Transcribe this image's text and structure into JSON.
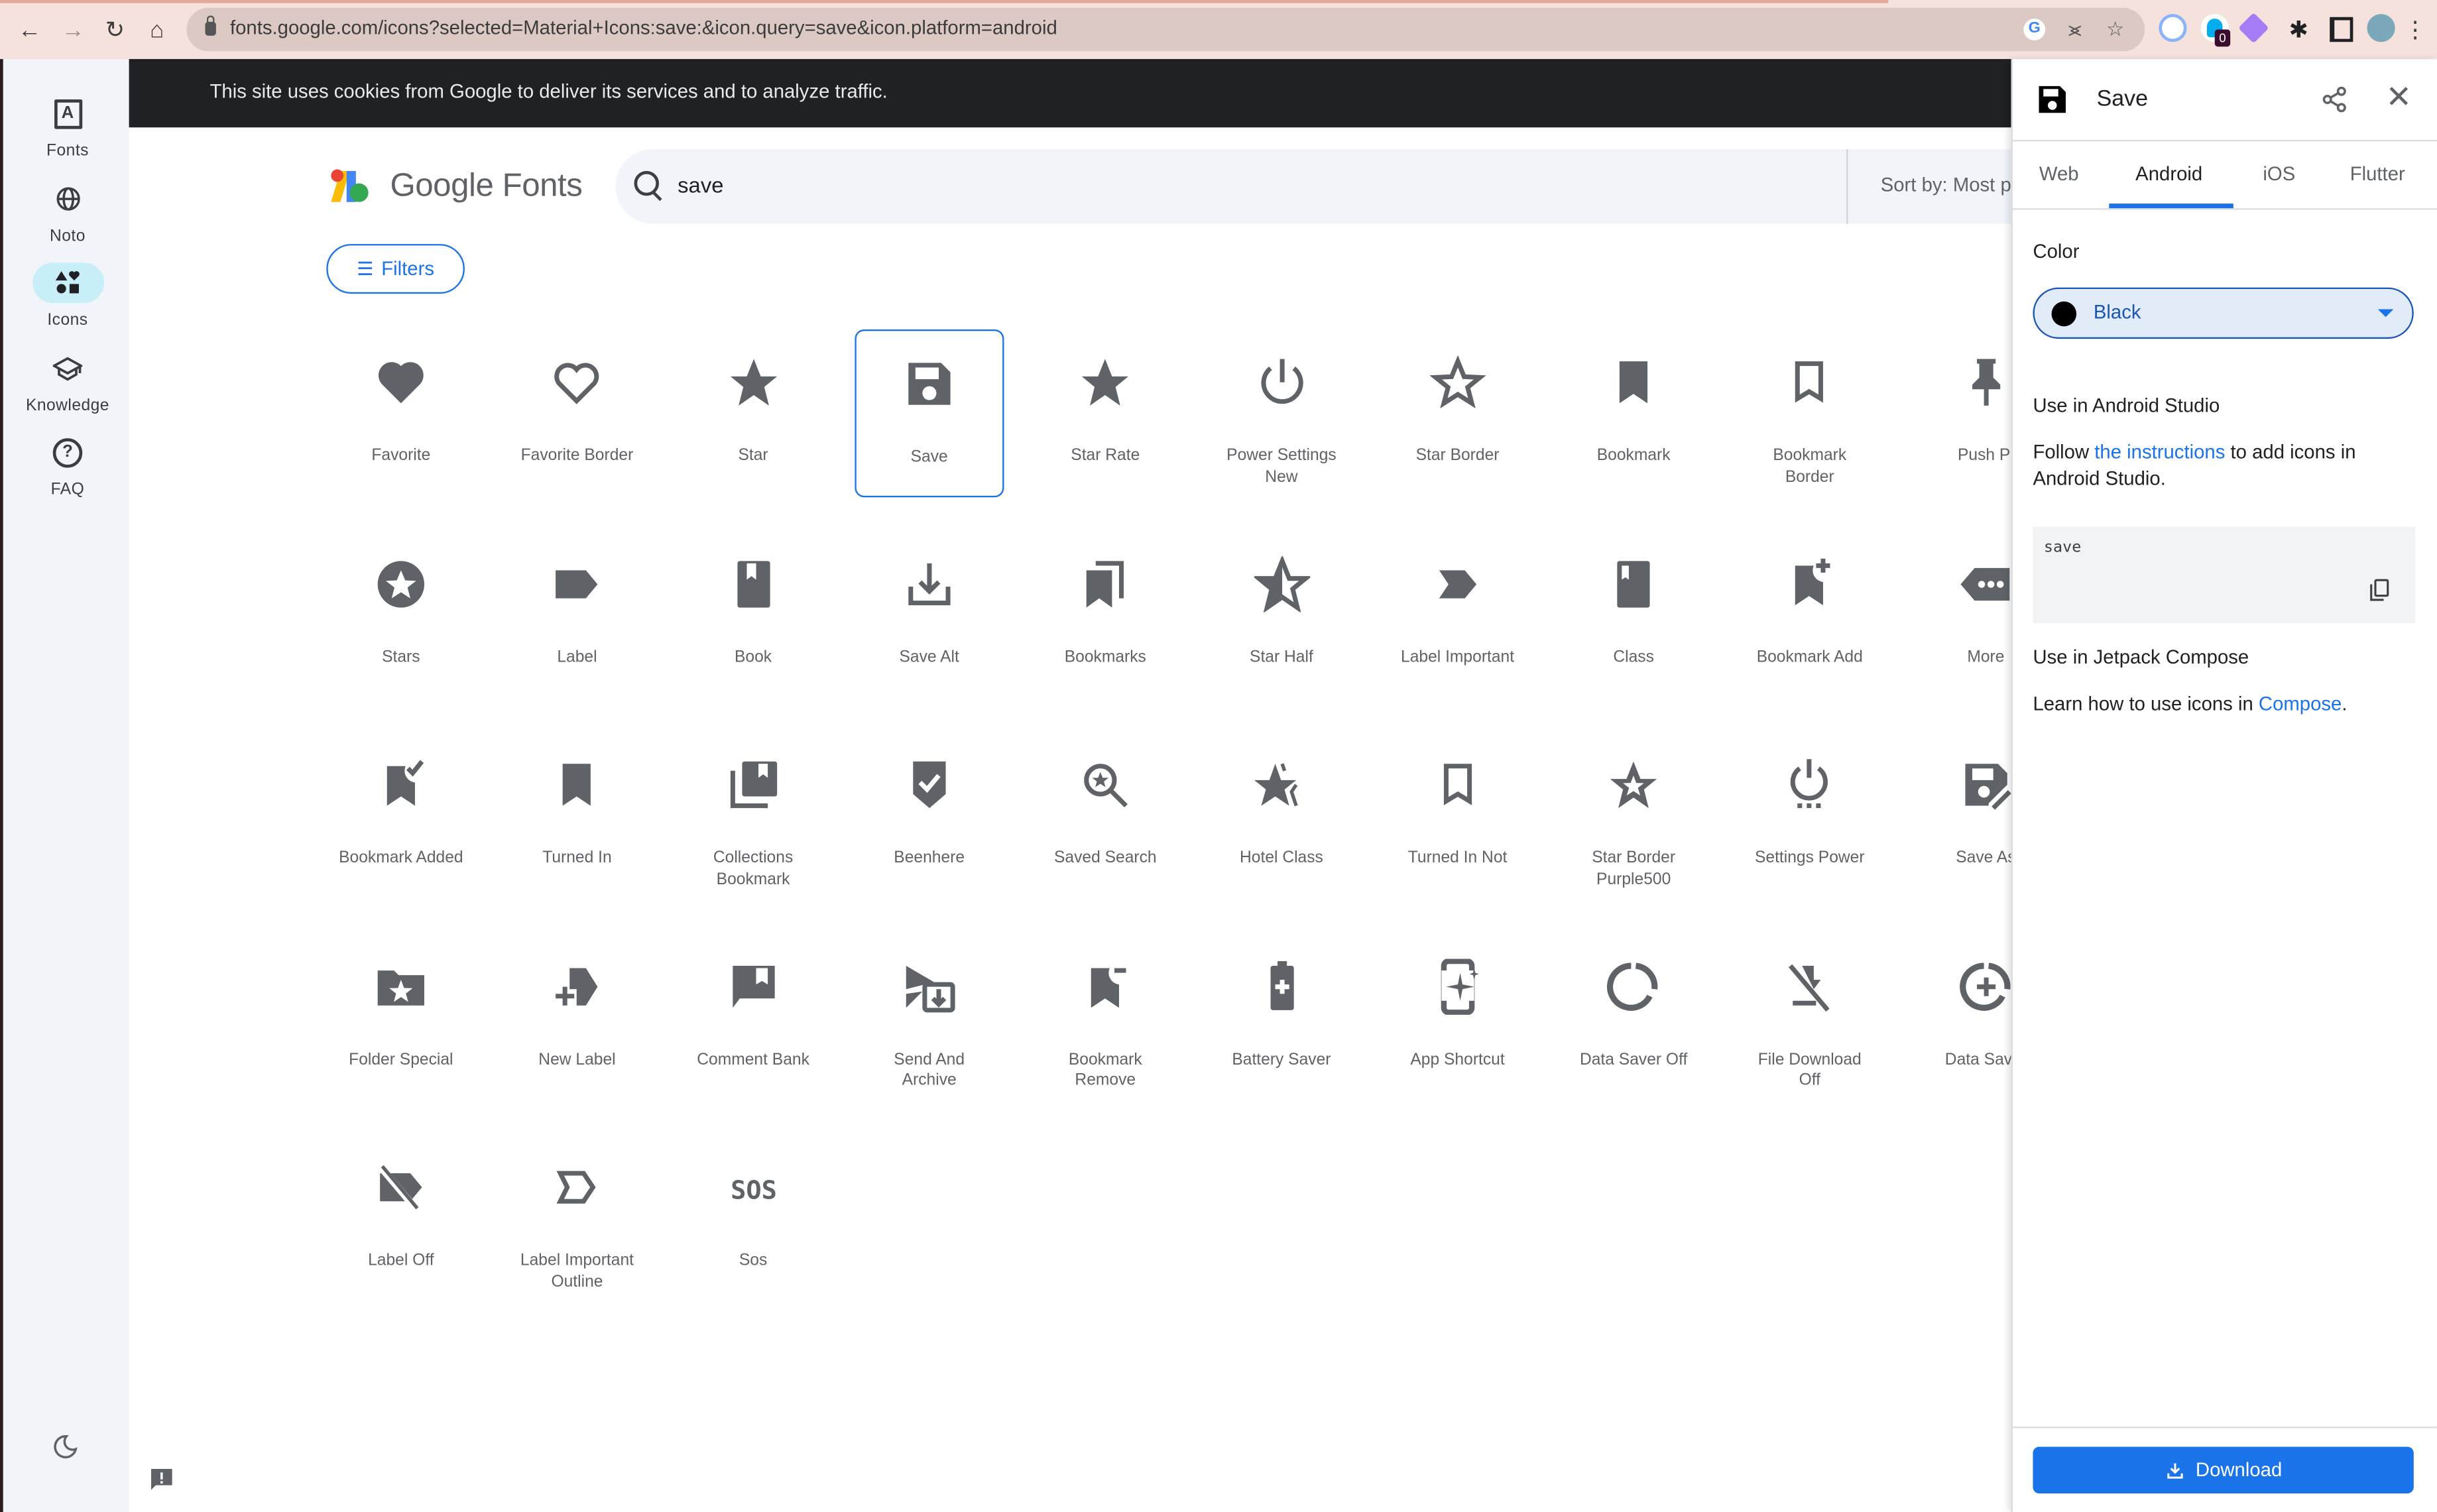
{
  "browser": {
    "url": "fonts.google.com/icons?selected=Material+Icons:save:&icon.query=save&icon.platform=android",
    "extension_badge": "0"
  },
  "rail": {
    "items": [
      {
        "label": "Fonts",
        "icon": "font-box-icon",
        "active": false
      },
      {
        "label": "Noto",
        "icon": "globe-icon",
        "active": false
      },
      {
        "label": "Icons",
        "icon": "shapes-icon",
        "active": true
      },
      {
        "label": "Knowledge",
        "icon": "school-icon",
        "active": false
      },
      {
        "label": "FAQ",
        "icon": "help-icon",
        "active": false
      }
    ]
  },
  "cookie_banner": {
    "text": "This site uses cookies from Google to deliver its services and to analyze traffic."
  },
  "header": {
    "logo_text": "Google Fonts",
    "search_value": "save",
    "sort_label": "Sort by: Most p",
    "filters_label": "Filters"
  },
  "icons": [
    {
      "label": "Favorite",
      "glyph": "favorite"
    },
    {
      "label": "Favorite Border",
      "glyph": "favorite_border"
    },
    {
      "label": "Star",
      "glyph": "star"
    },
    {
      "label": "Save",
      "glyph": "save",
      "selected": true
    },
    {
      "label": "Star Rate",
      "glyph": "star"
    },
    {
      "label": "Power Settings New",
      "glyph": "power"
    },
    {
      "label": "Star Border",
      "glyph": "star_border"
    },
    {
      "label": "Bookmark",
      "glyph": "bookmark"
    },
    {
      "label": "Bookmark Border",
      "glyph": "bookmark_border"
    },
    {
      "label": "Push Pi",
      "glyph": "push_pin"
    },
    {
      "label": "Stars",
      "glyph": "stars"
    },
    {
      "label": "Label",
      "glyph": "label"
    },
    {
      "label": "Book",
      "glyph": "book"
    },
    {
      "label": "Save Alt",
      "glyph": "save_alt"
    },
    {
      "label": "Bookmarks",
      "glyph": "bookmarks"
    },
    {
      "label": "Star Half",
      "glyph": "star_half"
    },
    {
      "label": "Label Important",
      "glyph": "label_important"
    },
    {
      "label": "Class",
      "glyph": "class"
    },
    {
      "label": "Bookmark Add",
      "glyph": "bookmark_add"
    },
    {
      "label": "More",
      "glyph": "more"
    },
    {
      "label": "Bookmark Added",
      "glyph": "bookmark_added"
    },
    {
      "label": "Turned In",
      "glyph": "bookmark"
    },
    {
      "label": "Collections Bookmark",
      "glyph": "collections_bookmark"
    },
    {
      "label": "Beenhere",
      "glyph": "beenhere"
    },
    {
      "label": "Saved Search",
      "glyph": "saved_search"
    },
    {
      "label": "Hotel Class",
      "glyph": "hotel_class"
    },
    {
      "label": "Turned In Not",
      "glyph": "bookmark_border"
    },
    {
      "label": "Star Border Purple500",
      "glyph": "star_border_purple"
    },
    {
      "label": "Settings Power",
      "glyph": "settings_power"
    },
    {
      "label": "Save As",
      "glyph": "save_as"
    },
    {
      "label": "Folder Special",
      "glyph": "folder_special"
    },
    {
      "label": "New Label",
      "glyph": "new_label"
    },
    {
      "label": "Comment Bank",
      "glyph": "comment_bank"
    },
    {
      "label": "Send And Archive",
      "glyph": "send_archive"
    },
    {
      "label": "Bookmark Remove",
      "glyph": "bookmark_remove"
    },
    {
      "label": "Battery Saver",
      "glyph": "battery_saver"
    },
    {
      "label": "App Shortcut",
      "glyph": "app_shortcut"
    },
    {
      "label": "Data Saver Off",
      "glyph": "data_saver_off"
    },
    {
      "label": "File Download Off",
      "glyph": "file_download_off"
    },
    {
      "label": "Data Saver",
      "glyph": "data_saver_on"
    },
    {
      "label": "Label Off",
      "glyph": "label_off"
    },
    {
      "label": "Label Important Outline",
      "glyph": "label_important_outline"
    },
    {
      "label": "Sos",
      "glyph": "sos"
    }
  ],
  "panel": {
    "title": "Save",
    "tabs": [
      {
        "label": "Web",
        "active": false
      },
      {
        "label": "Android",
        "active": true
      },
      {
        "label": "iOS",
        "active": false
      },
      {
        "label": "Flutter",
        "active": false
      }
    ],
    "color_label": "Color",
    "color_value": "Black",
    "color_swatch": "#000000",
    "android_studio_heading": "Use in Android Studio",
    "android_studio_text_before": "Follow ",
    "android_studio_link": "the instructions",
    "android_studio_text_after": " to add icons in Android Studio.",
    "code_snippet": "save",
    "compose_heading": "Use in Jetpack Compose",
    "compose_text_before": "Learn how to use icons in ",
    "compose_link": "Compose",
    "compose_text_after": ".",
    "download_label": "Download"
  },
  "colors": {
    "accent": "#1a73e8",
    "icon_gray": "#5f6368",
    "rail_active": "#c8eef7",
    "cookie_bg": "#202124"
  }
}
